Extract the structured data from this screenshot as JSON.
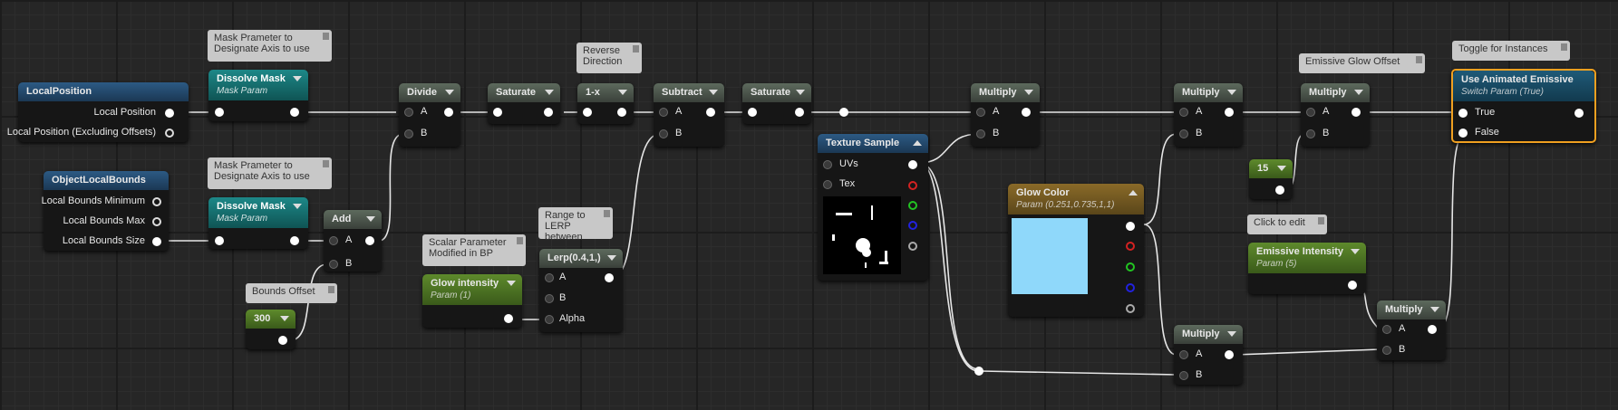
{
  "comments": {
    "mask1": "Mask Prameter to Designate Axis to use",
    "mask2": "Mask Prameter to Designate Axis to use",
    "reverse": "Reverse Direction",
    "bounds_offset": "Bounds Offset",
    "scalar": "Scalar Parameter Modified in BP",
    "lerp_range": "Range to LERP between",
    "glow_offset": "Emissive Glow Offset",
    "toggle": "Toggle for Instances",
    "click_edit": "Click to edit"
  },
  "nodes": {
    "local_position": {
      "title": "LocalPosition",
      "pins": [
        "Local Position",
        "Local Position (Excluding Offsets)"
      ]
    },
    "object_bounds": {
      "title": "ObjectLocalBounds",
      "pins": [
        "Local Bounds Minimum",
        "Local Bounds Max",
        "Local Bounds Size"
      ]
    },
    "dissolve1": {
      "title": "Dissolve Mask",
      "sub": "Mask Param"
    },
    "dissolve2": {
      "title": "Dissolve Mask",
      "sub": "Mask Param"
    },
    "add": {
      "title": "Add",
      "a": "A",
      "b": "B"
    },
    "const300": {
      "title": "300"
    },
    "divide": {
      "title": "Divide",
      "a": "A",
      "b": "B"
    },
    "saturate1": {
      "title": "Saturate"
    },
    "oneminus": {
      "title": "1-x"
    },
    "subtract": {
      "title": "Subtract",
      "a": "A",
      "b": "B"
    },
    "saturate2": {
      "title": "Saturate"
    },
    "glow_intensity": {
      "title": "Glow intensity",
      "sub": "Param (1)"
    },
    "lerp": {
      "title": "Lerp(0.4,1,)",
      "a": "A",
      "b": "B",
      "alpha": "Alpha"
    },
    "texture": {
      "title": "Texture Sample",
      "uvs": "UVs",
      "tex": "Tex"
    },
    "multiply1": {
      "title": "Multiply",
      "a": "A",
      "b": "B"
    },
    "glow_color": {
      "title": "Glow Color",
      "sub": "Param (0.251,0.735,1,1)",
      "color": "#8fd8fa"
    },
    "multiply2": {
      "title": "Multiply",
      "a": "A",
      "b": "B"
    },
    "multiply_lower": {
      "title": "Multiply",
      "a": "A",
      "b": "B"
    },
    "const15": {
      "title": "15"
    },
    "multiply3": {
      "title": "Multiply",
      "a": "A",
      "b": "B"
    },
    "emissive_intensity": {
      "title": "Emissive Intensity",
      "sub": "Param (5)"
    },
    "multiply4": {
      "title": "Multiply",
      "a": "A",
      "b": "B"
    },
    "animated": {
      "title": "Use Animated Emissive",
      "sub": "Switch Param (True)",
      "true_label": "True",
      "false_label": "False"
    }
  }
}
